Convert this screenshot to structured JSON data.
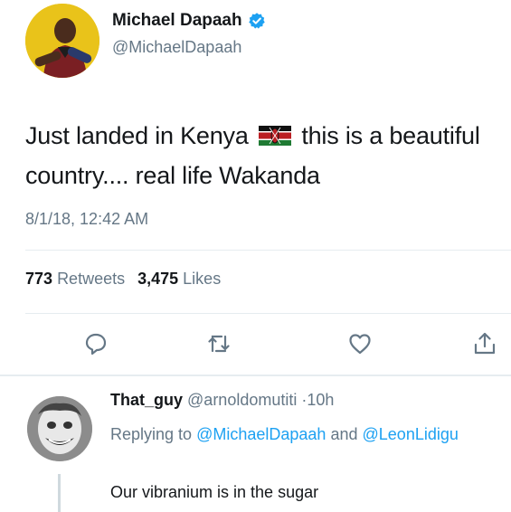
{
  "author": {
    "name": "Michael Dapaah",
    "handle": "@MichaelDapaah",
    "verified": true
  },
  "tweet": {
    "text_before_flag": "Just landed in Kenya",
    "flag": "kenya-flag-icon",
    "text_after_flag": "this is a beautiful country.... real life Wakanda",
    "timestamp": "8/1/18, 12:42 AM"
  },
  "stats": {
    "retweets_count": "773",
    "retweets_label": "Retweets",
    "likes_count": "3,475",
    "likes_label": "Likes"
  },
  "actions": [
    "reply-icon",
    "retweet-icon",
    "like-icon",
    "share-icon"
  ],
  "reply": {
    "name": "That_guy",
    "handle": "@arnoldomutiti",
    "separator": "·",
    "time": "10h",
    "replying_prefix": "Replying to",
    "replying_user1": "@MichaelDapaah",
    "replying_and": "and",
    "replying_user2": "@LeonLidigu",
    "text": "Our vibranium is in the sugar"
  },
  "colors": {
    "text": "#14171a",
    "secondary": "#657786",
    "link": "#1da1f2",
    "divider": "#e6ecf0"
  }
}
